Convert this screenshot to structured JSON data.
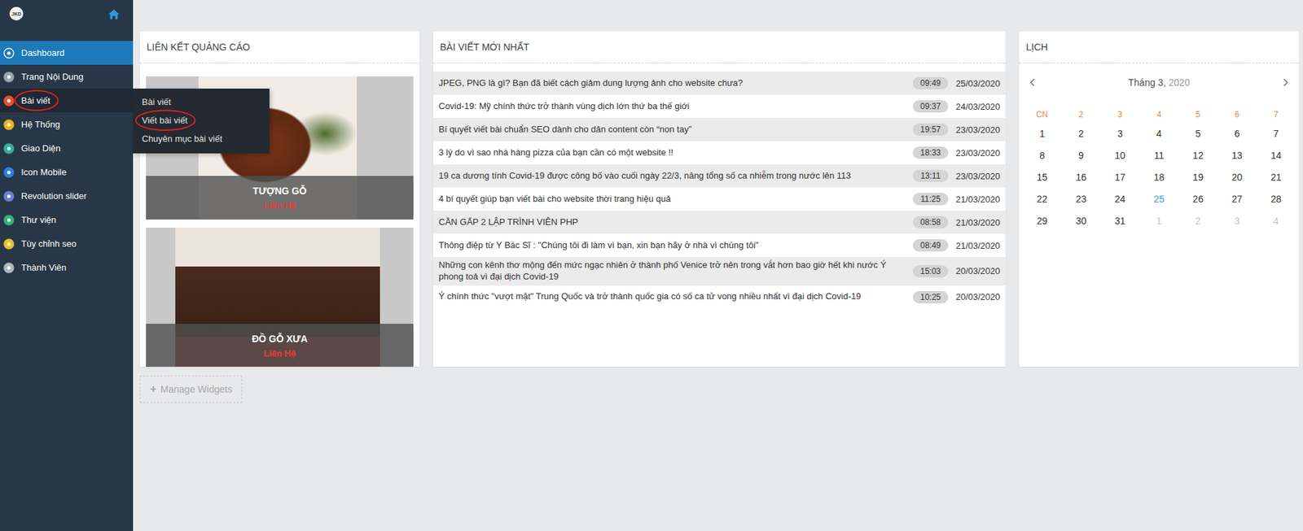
{
  "sidebar": {
    "logo": "JKD",
    "items": [
      {
        "label": "Dashboard",
        "color": "#ffffff",
        "selected": true,
        "hovered": false,
        "expanded": false,
        "circled": false,
        "submenu": []
      },
      {
        "label": "Trang Nội Dung",
        "color": "#9aa4ae",
        "selected": false,
        "hovered": false,
        "expanded": false,
        "circled": false,
        "submenu": []
      },
      {
        "label": "Bài viết",
        "color": "#e8532f",
        "selected": false,
        "hovered": true,
        "expanded": true,
        "circled": true,
        "submenu": [
          {
            "label": "Bài viết",
            "circled": false
          },
          {
            "label": "Viết bài viết",
            "circled": true
          },
          {
            "label": "Chuyên mục bài viết",
            "circled": false
          }
        ]
      },
      {
        "label": "Hệ Thống",
        "color": "#f2b01e",
        "selected": false,
        "hovered": false,
        "expanded": false,
        "circled": false,
        "submenu": []
      },
      {
        "label": "Giao Diện",
        "color": "#2fb39a",
        "selected": false,
        "hovered": false,
        "expanded": false,
        "circled": false,
        "submenu": []
      },
      {
        "label": "Icon Mobile",
        "color": "#2d7fe0",
        "selected": false,
        "hovered": false,
        "expanded": false,
        "circled": false,
        "submenu": []
      },
      {
        "label": "Revolution slider",
        "color": "#6b7fd8",
        "selected": false,
        "hovered": false,
        "expanded": false,
        "circled": false,
        "submenu": []
      },
      {
        "label": "Thư viện",
        "color": "#2fb37a",
        "selected": false,
        "hovered": false,
        "expanded": false,
        "circled": false,
        "submenu": []
      },
      {
        "label": "Tùy chỉnh seo",
        "color": "#e6c229",
        "selected": false,
        "hovered": false,
        "expanded": false,
        "circled": false,
        "submenu": []
      },
      {
        "label": "Thành Viên",
        "color": "#aeb6bf",
        "selected": false,
        "hovered": false,
        "expanded": false,
        "circled": false,
        "submenu": []
      }
    ]
  },
  "ads_widget": {
    "title": "LIÊN KẾT QUẢNG CÁO",
    "ads": [
      {
        "title": "TƯỢNG GỖ",
        "link": "Liên Hệ"
      },
      {
        "title": "ĐỒ GỖ XƯA",
        "link": "Liên Hệ"
      }
    ]
  },
  "posts_widget": {
    "title": "BÀI VIẾT MỚI NHẤT",
    "rows": [
      {
        "title": "JPEG, PNG là gì? Bạn đã biết cách giảm dung lượng ảnh cho website chưa?",
        "time": "09:49",
        "date": "25/03/2020"
      },
      {
        "title": "Covid-19: Mỹ chính thức trở thành vùng dịch lớn thứ ba thế giới",
        "time": "09:37",
        "date": "24/03/2020"
      },
      {
        "title": "Bí quyết viết bài chuẩn SEO dành cho dân content còn “non tay”",
        "time": "19:57",
        "date": "23/03/2020"
      },
      {
        "title": "3 lý do vì sao nhà hàng pizza của bạn cần có một website !!",
        "time": "18:33",
        "date": "23/03/2020"
      },
      {
        "title": "19 ca dương tính Covid-19 được công bố vào cuối ngày 22/3, nâng tổng số ca nhiễm trong nước lên 113",
        "time": "13:11",
        "date": "23/03/2020"
      },
      {
        "title": "4 bí quyết giúp bạn viết bài cho website thời trang hiệu quả",
        "time": "11:25",
        "date": "21/03/2020"
      },
      {
        "title": "CẦN GẤP 2 LẬP TRÌNH VIÊN PHP",
        "time": "08:58",
        "date": "21/03/2020"
      },
      {
        "title": "Thông điệp từ Y Bác Sĩ : \"Chúng tôi đi làm vì bạn, xin bạn hãy ở nhà vì chúng tôi\"",
        "time": "08:49",
        "date": "21/03/2020"
      },
      {
        "title": "Những con kênh thơ mộng đến mức ngạc nhiên ở thành phố Venice trở nên trong vắt hơn bao giờ hết khi nước Ý phong toả vì đại dịch Covid-19",
        "time": "15:03",
        "date": "20/03/2020"
      },
      {
        "title": "Ý chính thức \"vượt mặt\" Trung Quốc và trở thành quốc gia có số ca tử vong nhiều nhất vì đại dịch Covid-19",
        "time": "10:25",
        "date": "20/03/2020"
      }
    ]
  },
  "calendar_widget": {
    "title": "LỊCH",
    "month": "Tháng 3,",
    "year": "2020",
    "weekdays": [
      "CN",
      "2",
      "3",
      "4",
      "5",
      "6",
      "7"
    ],
    "days": [
      {
        "label": "1",
        "in_month": true,
        "today": false
      },
      {
        "label": "2",
        "in_month": true,
        "today": false
      },
      {
        "label": "3",
        "in_month": true,
        "today": false
      },
      {
        "label": "4",
        "in_month": true,
        "today": false
      },
      {
        "label": "5",
        "in_month": true,
        "today": false
      },
      {
        "label": "6",
        "in_month": true,
        "today": false
      },
      {
        "label": "7",
        "in_month": true,
        "today": false
      },
      {
        "label": "8",
        "in_month": true,
        "today": false
      },
      {
        "label": "9",
        "in_month": true,
        "today": false
      },
      {
        "label": "10",
        "in_month": true,
        "today": false
      },
      {
        "label": "11",
        "in_month": true,
        "today": false
      },
      {
        "label": "12",
        "in_month": true,
        "today": false
      },
      {
        "label": "13",
        "in_month": true,
        "today": false
      },
      {
        "label": "14",
        "in_month": true,
        "today": false
      },
      {
        "label": "15",
        "in_month": true,
        "today": false
      },
      {
        "label": "16",
        "in_month": true,
        "today": false
      },
      {
        "label": "17",
        "in_month": true,
        "today": false
      },
      {
        "label": "18",
        "in_month": true,
        "today": false
      },
      {
        "label": "19",
        "in_month": true,
        "today": false
      },
      {
        "label": "20",
        "in_month": true,
        "today": false
      },
      {
        "label": "21",
        "in_month": true,
        "today": false
      },
      {
        "label": "22",
        "in_month": true,
        "today": false
      },
      {
        "label": "23",
        "in_month": true,
        "today": false
      },
      {
        "label": "24",
        "in_month": true,
        "today": false
      },
      {
        "label": "25",
        "in_month": true,
        "today": true
      },
      {
        "label": "26",
        "in_month": true,
        "today": false
      },
      {
        "label": "27",
        "in_month": true,
        "today": false
      },
      {
        "label": "28",
        "in_month": true,
        "today": false
      },
      {
        "label": "29",
        "in_month": true,
        "today": false
      },
      {
        "label": "30",
        "in_month": true,
        "today": false
      },
      {
        "label": "31",
        "in_month": true,
        "today": false
      },
      {
        "label": "1",
        "in_month": false,
        "today": false
      },
      {
        "label": "2",
        "in_month": false,
        "today": false
      },
      {
        "label": "3",
        "in_month": false,
        "today": false
      },
      {
        "label": "4",
        "in_month": false,
        "today": false
      }
    ]
  },
  "manage_widgets": {
    "icon": "+",
    "label": "Manage Widgets"
  }
}
